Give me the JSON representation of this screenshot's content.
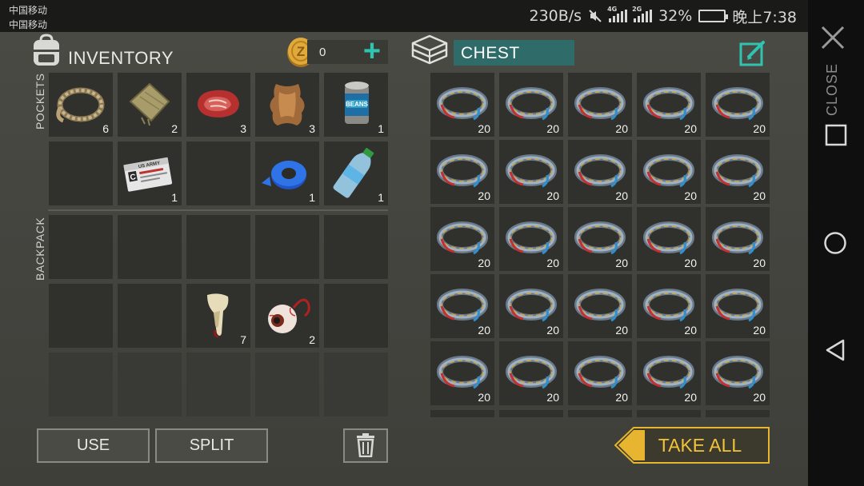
{
  "status_bar": {
    "carrier_1": "中国移动",
    "carrier_2": "中国移动",
    "network_speed": "230B/s",
    "signal_1_label": "4G",
    "signal_2_label": "2G",
    "battery_percent": "32%",
    "battery_level": 0.32,
    "time": "晚上7:38",
    "battery_color": "#3ccf4e"
  },
  "inventory": {
    "title": "INVENTORY",
    "coins": "0",
    "add_icon": "plus-icon",
    "pockets_label": "POCKETS",
    "backpack_label": "BACKPACK",
    "pockets": [
      {
        "item": "rope",
        "qty": "6"
      },
      {
        "item": "cloth",
        "qty": "2"
      },
      {
        "item": "raw-meat",
        "qty": "3"
      },
      {
        "item": "animal-hide",
        "qty": "3"
      },
      {
        "item": "canned-beans",
        "qty": "1"
      },
      {
        "item": "",
        "qty": ""
      },
      {
        "item": "army-id-card",
        "qty": "1"
      },
      {
        "item": "",
        "qty": ""
      },
      {
        "item": "duct-tape",
        "qty": "1"
      },
      {
        "item": "water-bottle",
        "qty": "1"
      }
    ],
    "backpack": [
      {
        "item": "",
        "qty": ""
      },
      {
        "item": "",
        "qty": ""
      },
      {
        "item": "",
        "qty": ""
      },
      {
        "item": "",
        "qty": ""
      },
      {
        "item": "",
        "qty": ""
      },
      {
        "item": "",
        "qty": ""
      },
      {
        "item": "",
        "qty": ""
      },
      {
        "item": "fang",
        "qty": "7"
      },
      {
        "item": "eyeball",
        "qty": "2"
      },
      {
        "item": "",
        "qty": ""
      }
    ],
    "id_card_text": {
      "line1": "US ARMY",
      "letter": "C"
    },
    "can_label": "BEANS"
  },
  "chest": {
    "title": "CHEST",
    "item": "wire-coil",
    "qty": "20",
    "rows": 5,
    "cols": 5
  },
  "buttons": {
    "use": "USE",
    "split": "SPLIT",
    "take_all": "TAKE ALL"
  },
  "nav": {
    "close_label": "CLOSE"
  },
  "colors": {
    "accent_teal": "#2ec4b0",
    "chest_title_bg": "#2f6b68",
    "take_all_gold": "#f2c33a",
    "slot_bg": "#30302d"
  }
}
